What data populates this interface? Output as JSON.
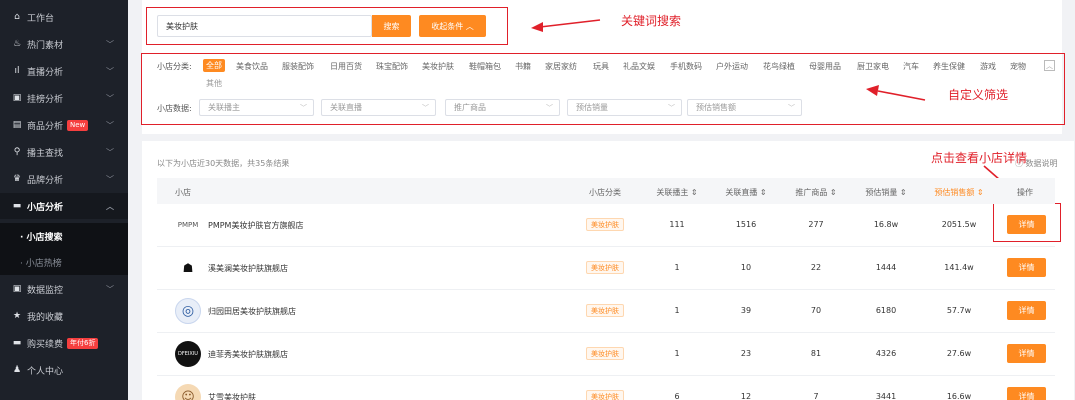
{
  "sidebar": {
    "items": [
      {
        "label": "工作台",
        "icon": "home-icon",
        "glyph": "⌂",
        "chevron": false
      },
      {
        "label": "热门素材",
        "icon": "fire-icon",
        "glyph": "♨",
        "chevron": true
      },
      {
        "label": "直播分析",
        "icon": "bar-chart-icon",
        "glyph": "ıl",
        "chevron": true
      },
      {
        "label": "挂榜分析",
        "icon": "image-icon",
        "glyph": "▣",
        "chevron": true
      },
      {
        "label": "商品分析",
        "icon": "bag-icon",
        "glyph": "▤",
        "chevron": true,
        "badge": "New"
      },
      {
        "label": "播主查找",
        "icon": "search-icon",
        "glyph": "⚲",
        "chevron": true
      },
      {
        "label": "品牌分析",
        "icon": "gift-icon",
        "glyph": "♛",
        "chevron": true
      },
      {
        "label": "小店分析",
        "icon": "store-icon",
        "glyph": "▬",
        "chevron": true,
        "active": true
      }
    ],
    "sub": [
      {
        "label": "· 小店搜索",
        "active": true
      },
      {
        "label": "· 小店热榜",
        "active": false
      }
    ],
    "items2": [
      {
        "label": "数据监控",
        "icon": "monitor-icon",
        "glyph": "▣",
        "chevron": true
      },
      {
        "label": "我的收藏",
        "icon": "star-icon",
        "glyph": "★",
        "chevron": false
      },
      {
        "label": "购买续费",
        "icon": "card-icon",
        "glyph": "▬",
        "chevron": false,
        "badge": "年付6折"
      },
      {
        "label": "个人中心",
        "icon": "user-icon",
        "glyph": "♟",
        "chevron": false
      }
    ]
  },
  "search": {
    "value": "美妆护肤",
    "button": "搜索",
    "collapse": "收起条件 ︿"
  },
  "annotations": {
    "keyword": "关键词搜索",
    "filter": "自定义筛选",
    "detail": "点击查看小店详情"
  },
  "filters": {
    "category_label": "小店分类:",
    "categories": [
      "全部",
      "美食饮品",
      "服装配饰",
      "日用百货",
      "珠宝配饰",
      "美妆护肤",
      "鞋帽箱包",
      "书籍",
      "家居家纺",
      "玩具",
      "礼品文娱",
      "手机数码",
      "户外运动",
      "花鸟绿植",
      "母婴用品",
      "厨卫家电",
      "汽车",
      "养生保健",
      "游戏",
      "宠物"
    ],
    "more": "其他",
    "collapse_icon": "︿",
    "data_label": "小店数据:",
    "selects": [
      "关联播主",
      "关联直播",
      "推广商品",
      "预估销量",
      "预估销售额"
    ],
    "select_arrow": "﹀"
  },
  "table": {
    "summary": "以下为小店近30天数据，共35条结果",
    "data_desc": "数据说明",
    "columns": [
      "小店",
      "小店分类",
      "关联播主 ⇕",
      "关联直播 ⇕",
      "推广商品 ⇕",
      "预估销量 ⇕",
      "预估销售额 ⇕",
      "操作"
    ],
    "rows": [
      {
        "logo": "PMPM",
        "name": "PMPM美妆护肤官方旗舰店",
        "category": "美妆护肤",
        "anchors": "111",
        "lives": "1516",
        "products": "277",
        "sales": "16.8w",
        "revenue": "2051.5w",
        "action": "详情"
      },
      {
        "logo": "☗",
        "name": "溪美澜美妆护肤旗舰店",
        "category": "美妆护肤",
        "anchors": "1",
        "lives": "10",
        "products": "22",
        "sales": "1444",
        "revenue": "141.4w",
        "action": "详情"
      },
      {
        "logo": "◎",
        "name": "归园田居美妆护肤旗舰店",
        "category": "美妆护肤",
        "anchors": "1",
        "lives": "39",
        "products": "70",
        "sales": "6180",
        "revenue": "57.7w",
        "action": "详情"
      },
      {
        "logo": "DFEIXIU",
        "name": "迪菲秀美妆护肤旗舰店",
        "category": "美妆护肤",
        "anchors": "1",
        "lives": "23",
        "products": "81",
        "sales": "4326",
        "revenue": "27.6w",
        "action": "详情"
      },
      {
        "logo": "☺",
        "name": "艾雪美妆护肤",
        "category": "美妆护肤",
        "anchors": "6",
        "lives": "12",
        "products": "7",
        "sales": "3441",
        "revenue": "16.6w",
        "action": "详情"
      }
    ]
  },
  "colors": {
    "accent": "#fe8a21",
    "annotation": "#e0202a",
    "sidebar": "#1d2129"
  }
}
